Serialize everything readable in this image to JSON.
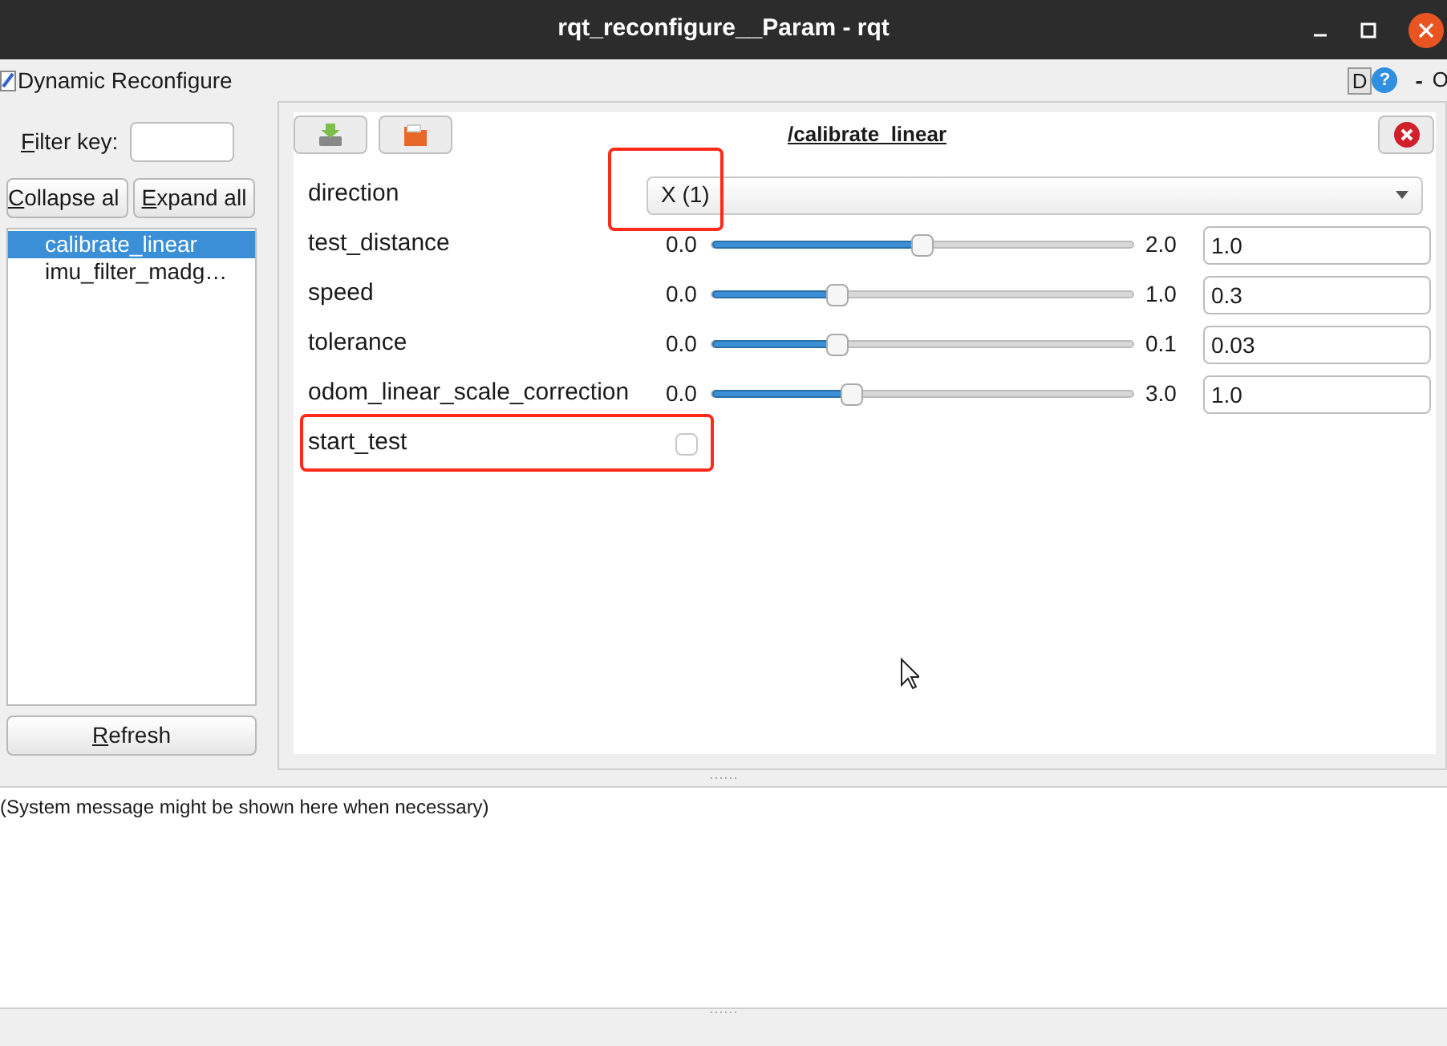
{
  "window": {
    "title": "rqt_reconfigure__Param - rqt"
  },
  "plugin": {
    "title": "Dynamic Reconfigure",
    "checked": true,
    "d_label": "D",
    "help_label": "?",
    "minimize_label": "-",
    "close_label": "O"
  },
  "filter": {
    "label": "Filter key:"
  },
  "buttons": {
    "collapse": "Collapse al",
    "expand": "Expand all",
    "refresh": "Refresh"
  },
  "tree": [
    {
      "label": "calibrate_linear",
      "selected": true
    },
    {
      "label": "imu_filter_madg…",
      "selected": false
    }
  ],
  "node": {
    "title": "/calibrate_linear"
  },
  "params": [
    {
      "kind": "enum",
      "name": "direction",
      "value": "X (1)",
      "highlighted": true
    },
    {
      "kind": "slider",
      "name": "test_distance",
      "min": "0.0",
      "max": "2.0",
      "value": "1.0",
      "level": 0.5,
      "highlighted": false
    },
    {
      "kind": "slider",
      "name": "speed",
      "min": "0.0",
      "max": "1.0",
      "value": "0.3",
      "level": 0.3,
      "highlighted": false
    },
    {
      "kind": "slider",
      "name": "tolerance",
      "min": "0.0",
      "max": "0.1",
      "value": "0.03",
      "level": 0.3,
      "highlighted": false
    },
    {
      "kind": "slider",
      "name": "odom_linear_scale_correction",
      "min": "0.0",
      "max": "3.0",
      "value": "1.0",
      "level": 0.333,
      "highlighted": false
    },
    {
      "kind": "bool",
      "name": "start_test",
      "checked": false,
      "highlighted": true
    }
  ],
  "message": "(System message might be shown here when necessary)"
}
